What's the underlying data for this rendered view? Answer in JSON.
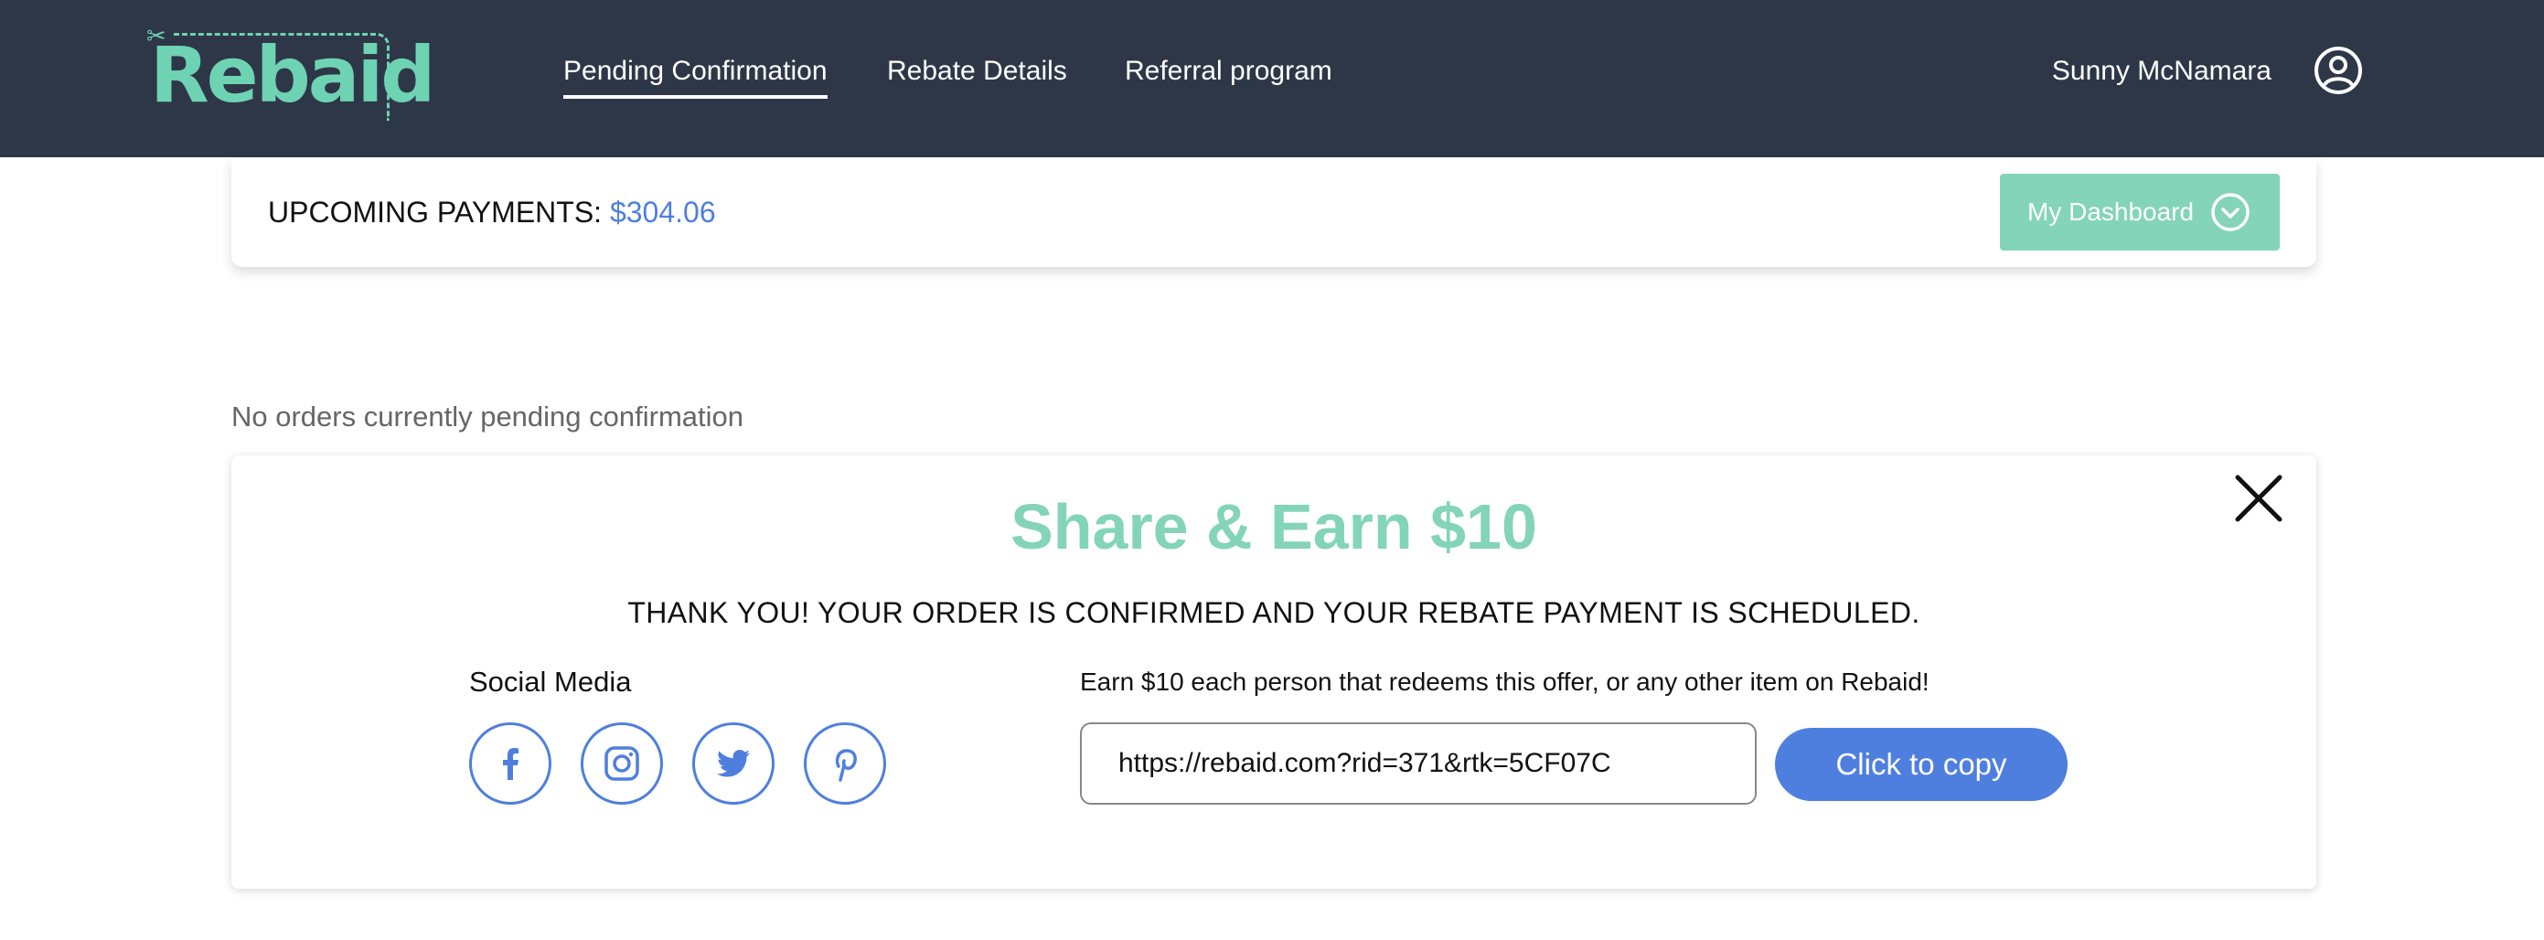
{
  "brand": {
    "logo_text": "Rebaid",
    "accent": "#6ed3b3"
  },
  "header": {
    "nav": [
      {
        "label": "Pending Confirmation",
        "active": true
      },
      {
        "label": "Rebate Details",
        "active": false
      },
      {
        "label": "Referral program",
        "active": false
      }
    ],
    "user_name": "Sunny McNamara",
    "user_icon": "user-circle-icon",
    "background": "#2e3748"
  },
  "payments": {
    "label": "UPCOMING PAYMENTS:",
    "amount": "$304.06",
    "dashboard_button": "My Dashboard",
    "dashboard_icon": "chevron-down-circle-icon",
    "button_color": "#83d4b8"
  },
  "orders": {
    "empty_text": "No orders currently pending confirmation"
  },
  "share": {
    "title": "Share & Earn $10",
    "subtitle": "THANK YOU! YOUR ORDER IS CONFIRMED AND YOUR REBATE PAYMENT IS SCHEDULED.",
    "social_label": "Social Media",
    "social_icons": [
      "facebook-icon",
      "instagram-icon",
      "twitter-icon",
      "pinterest-icon"
    ],
    "earn_text": "Earn $10 each person that redeems this offer, or any other item on Rebaid!",
    "referral_link": "https://rebaid.com?rid=371&rtk=5CF07C",
    "copy_button": "Click to copy",
    "close_icon": "close-icon",
    "link_color": "#4f7fde"
  }
}
